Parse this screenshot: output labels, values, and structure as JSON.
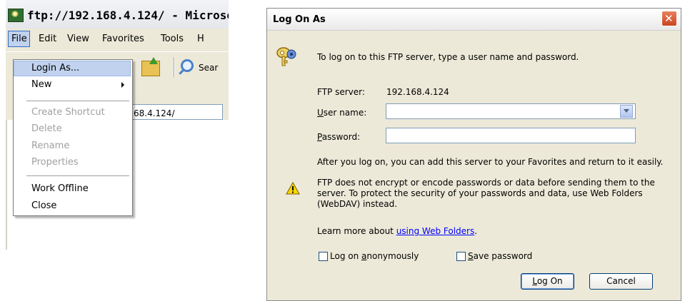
{
  "ie": {
    "title": "ftp://192.168.4.124/ - Microsof",
    "menubar": [
      "File",
      "Edit",
      "View",
      "Favorites",
      "Tools",
      "H"
    ],
    "toolbar": {
      "search_label": "Sear"
    },
    "address": "68.4.124/"
  },
  "file_menu": {
    "items": [
      {
        "label": "Login As...",
        "state": "highlighted"
      },
      {
        "label": "New",
        "submenu": true
      },
      {
        "label": "Create Shortcut",
        "state": "disabled"
      },
      {
        "label": "Delete",
        "state": "disabled"
      },
      {
        "label": "Rename",
        "state": "disabled"
      },
      {
        "label": "Properties",
        "state": "disabled"
      },
      {
        "label": "Work Offline"
      },
      {
        "label": "Close"
      }
    ]
  },
  "dialog": {
    "title": "Log On As",
    "intro": "To log on to this FTP server, type a user name and password.",
    "server_label": "FTP server:",
    "server_value": "192.168.4.124",
    "username_label_first": "U",
    "username_label_rest": "ser name:",
    "username_value": "",
    "password_label_first": "P",
    "password_label_rest": "assword:",
    "password_value": "",
    "favorites_note": "After you log on, you can add this server to your Favorites and return to it easily.",
    "warning_line1": "FTP does not encrypt or encode passwords or data before sending them to the",
    "warning_line2": "server.  To protect the security of your passwords and data, use Web Folders",
    "warning_line3": "(WebDAV) instead.",
    "learn_prefix": "Learn more about ",
    "learn_link": "using Web Folders",
    "learn_suffix": ".",
    "anon_label_a": "Log on ",
    "anon_label_b": "a",
    "anon_label_c": "nonymously",
    "anon_checked": false,
    "save_label_a": "S",
    "save_label_b": "ave password",
    "save_checked": false,
    "logon_label_a": "L",
    "logon_label_b": "og On",
    "cancel_label": "Cancel"
  },
  "colors": {
    "menu_highlight": "#c1d2ee",
    "dialog_face": "#ece9d8",
    "link": "#0000ff",
    "close_button": "#c94522"
  }
}
